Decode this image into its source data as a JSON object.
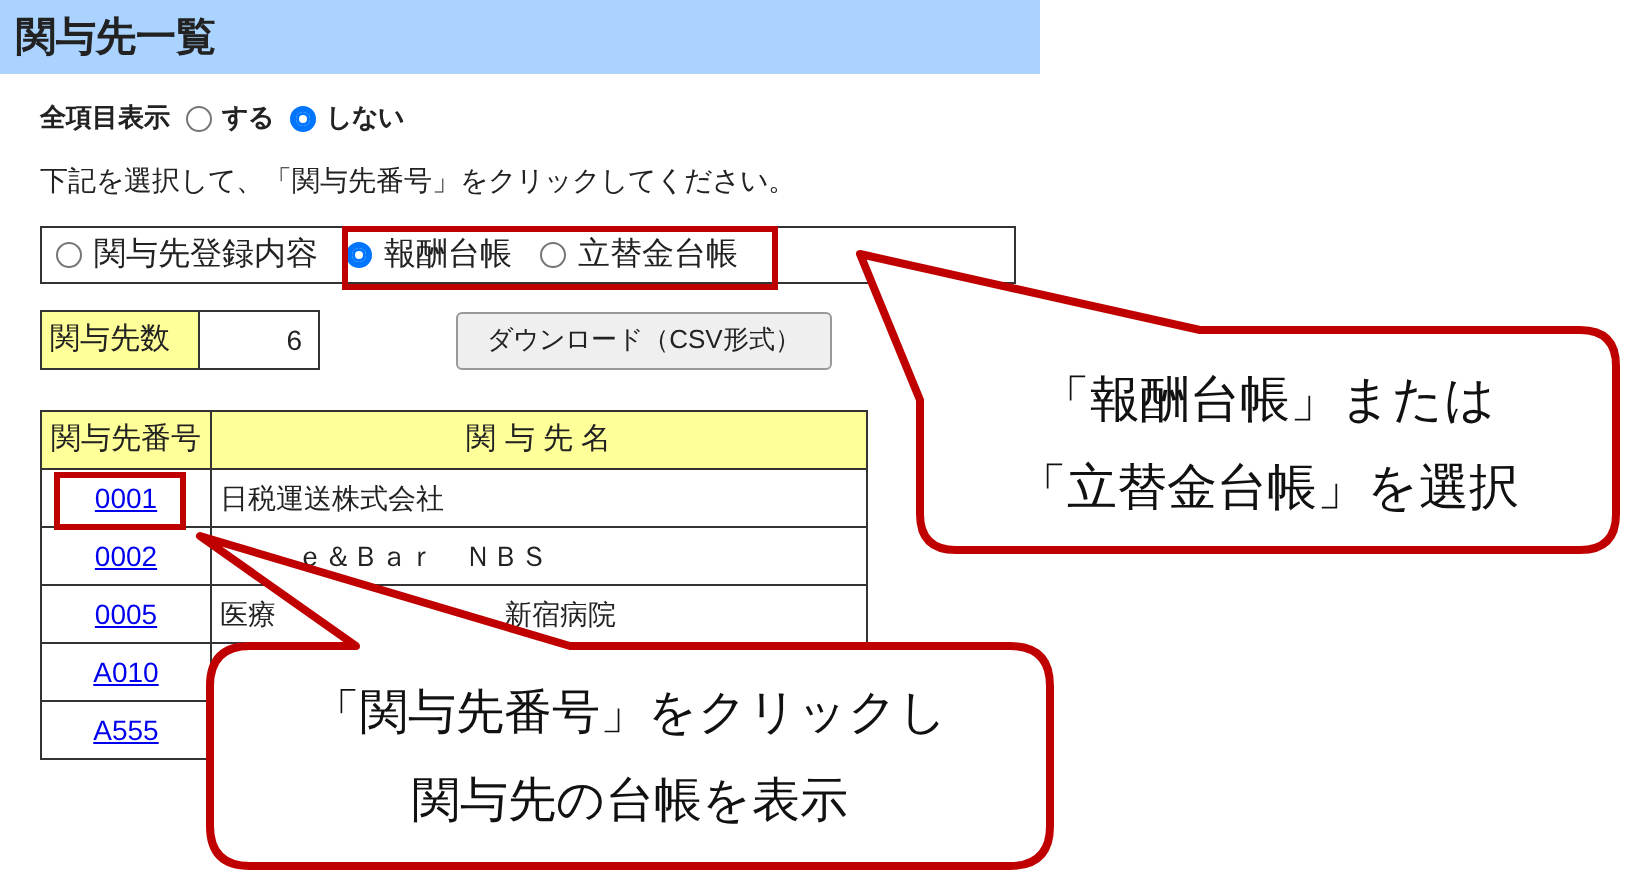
{
  "page_title": "関与先一覧",
  "show_all": {
    "label": "全項目表示",
    "options": [
      {
        "label": "する",
        "selected": false
      },
      {
        "label": "しない",
        "selected": true
      }
    ]
  },
  "instruction": "下記を選択して、「関与先番号」をクリックしてください。",
  "view_options": [
    {
      "label": "関与先登録内容",
      "selected": false
    },
    {
      "label": "報酬台帳",
      "selected": true
    },
    {
      "label": "立替金台帳",
      "selected": false
    }
  ],
  "client_count": {
    "label": "関与先数",
    "value": "6"
  },
  "download_button": "ダウンロード（CSV形式）",
  "table": {
    "columns": [
      "関与先番号",
      "関 与 先 名"
    ],
    "rows": [
      {
        "number": "0001",
        "name_parts": [
          {
            "kind": "text",
            "text": "日税運送株式会社"
          }
        ]
      },
      {
        "number": "0002",
        "name_parts": [
          {
            "kind": "hidden"
          },
          {
            "kind": "text",
            "text": "ｅ＆Ｂａｒ　ＮＢＳ"
          }
        ]
      },
      {
        "number": "0005",
        "name_parts": [
          {
            "kind": "text",
            "text": "医療"
          },
          {
            "kind": "hidden"
          },
          {
            "kind": "hidden"
          },
          {
            "kind": "hidden"
          },
          {
            "kind": "text",
            "text": "新宿病院"
          }
        ]
      },
      {
        "number": "A010"
      },
      {
        "number": "A555"
      }
    ]
  },
  "callouts": [
    {
      "lines": [
        "「報酬台帳」または",
        "「立替金台帳」を選択"
      ]
    },
    {
      "lines": [
        "「関与先番号」をクリックし",
        "関与先の台帳を表示"
      ]
    }
  ]
}
